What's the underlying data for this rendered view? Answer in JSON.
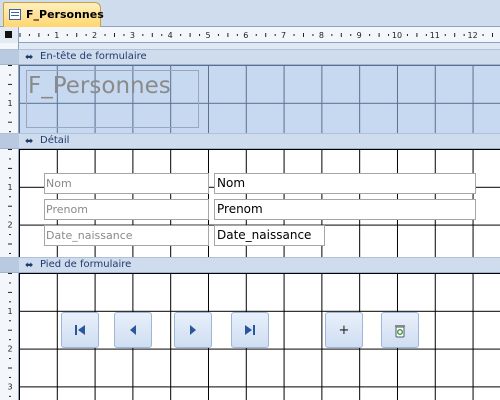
{
  "tab": {
    "label": "F_Personnes",
    "icon": "form-icon"
  },
  "ruler": {
    "labels": [
      "1",
      "2",
      "3",
      "4",
      "5",
      "6",
      "7",
      "8",
      "9",
      "10",
      "11",
      "12"
    ]
  },
  "sections": {
    "header": {
      "title": "En-tête de formulaire",
      "form_title": "F_Personnes"
    },
    "detail": {
      "title": "Détail",
      "rows": [
        {
          "label": "Nom",
          "field": "Nom"
        },
        {
          "label": "Prenom",
          "field": "Prenom"
        },
        {
          "label": "Date_naissance",
          "field": "Date_naissance"
        }
      ]
    },
    "footer": {
      "title": "Pied de formulaire",
      "buttons": [
        {
          "name": "first-record-button",
          "icon": "first-record-icon"
        },
        {
          "name": "previous-record-button",
          "icon": "previous-record-icon"
        },
        {
          "name": "next-record-button",
          "icon": "next-record-icon"
        },
        {
          "name": "last-record-button",
          "icon": "last-record-icon"
        },
        {
          "name": "add-record-button",
          "label": "+"
        },
        {
          "name": "delete-record-button",
          "icon": "recycle-bin-icon"
        }
      ]
    }
  },
  "colors": {
    "header_fill": "#c6d9f1",
    "tab_active": "#ffd66e",
    "section_bar": "#cfdcee"
  }
}
